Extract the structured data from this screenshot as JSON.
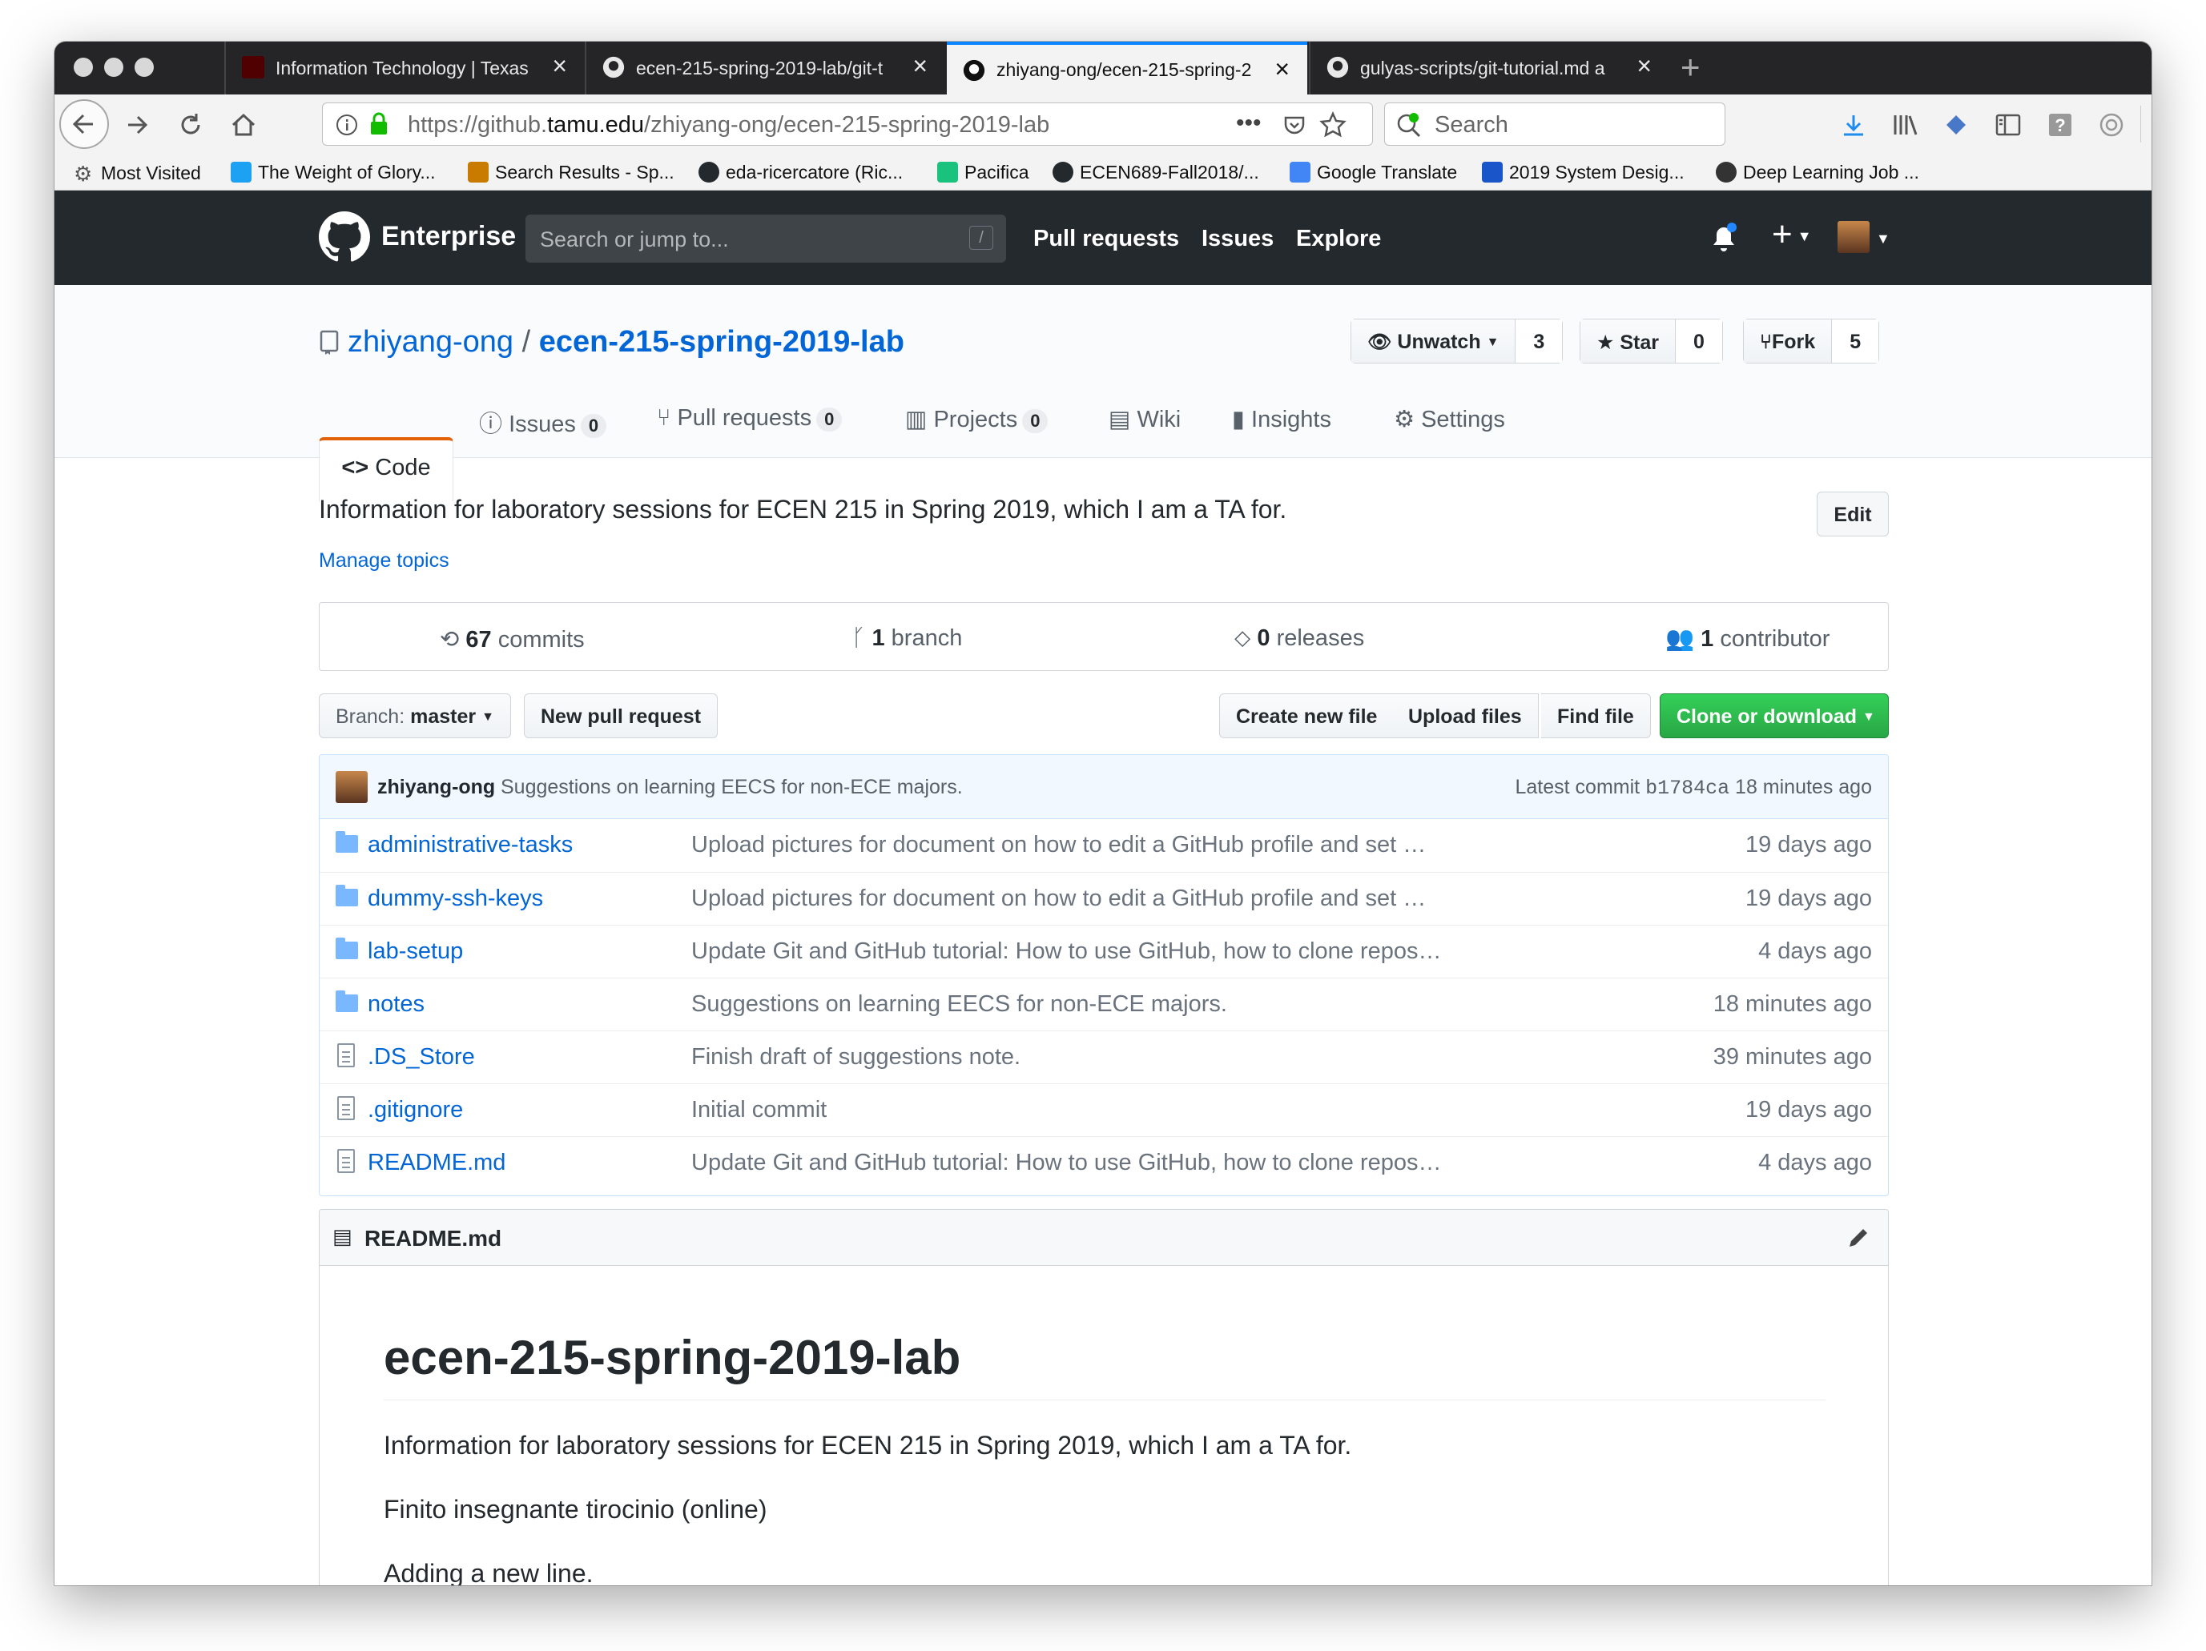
{
  "browser": {
    "tabs": [
      {
        "title": "Information Technology | Texas",
        "active": false
      },
      {
        "title": "ecen-215-spring-2019-lab/git-t",
        "active": false
      },
      {
        "title": "zhiyang-ong/ecen-215-spring-2",
        "active": true
      },
      {
        "title": "gulyas-scripts/git-tutorial.md a",
        "active": false
      }
    ],
    "url_prefix": "https://github.",
    "url_domain": "tamu.edu",
    "url_path": "/zhiyang-ong/ecen-215-spring-2019-lab",
    "more": "•••",
    "search_placeholder": "Search",
    "bookmarks": [
      {
        "label": "Most Visited",
        "color": "#777777"
      },
      {
        "label": "The Weight of Glory...",
        "color": "#1da1f2"
      },
      {
        "label": "Search Results - Sp...",
        "color": "#c97b00"
      },
      {
        "label": "eda-ricercatore (Ric...",
        "color": "#24292e"
      },
      {
        "label": "Pacifica",
        "color": "#19c37d"
      },
      {
        "label": "ECEN689-Fall2018/...",
        "color": "#24292e"
      },
      {
        "label": "Google Translate",
        "color": "#4285f4"
      },
      {
        "label": "2019 System Desig...",
        "color": "#1a56c9"
      },
      {
        "label": "Deep Learning Job ...",
        "color": "#333333"
      }
    ]
  },
  "github_header": {
    "brand": "Enterprise",
    "search_placeholder": "Search or jump to...",
    "search_key": "/",
    "nav": [
      "Pull requests",
      "Issues",
      "Explore"
    ],
    "plus": "+"
  },
  "repo": {
    "owner": "zhiyang-ong",
    "separator": "/",
    "name": "ecen-215-spring-2019-lab",
    "unwatch_label": "Unwatch",
    "watch_count": "3",
    "star_label": "Star",
    "star_count": "0",
    "fork_label": "Fork",
    "fork_count": "5",
    "tabs": [
      {
        "label": "Code"
      },
      {
        "label": "Issues",
        "count": "0"
      },
      {
        "label": "Pull requests",
        "count": "0"
      },
      {
        "label": "Projects",
        "count": "0"
      },
      {
        "label": "Wiki"
      },
      {
        "label": "Insights"
      },
      {
        "label": "Settings"
      }
    ],
    "description": "Information for laboratory sessions for ECEN 215 in Spring 2019, which I am a TA for.",
    "edit_label": "Edit",
    "manage_topics": "Manage topics",
    "summary": {
      "commits_num": "67",
      "commits_label": "commits",
      "branch_num": "1",
      "branch_label": "branch",
      "releases_num": "0",
      "releases_label": "releases",
      "contrib_num": "1",
      "contrib_label": "contributor"
    },
    "branch_prefix": "Branch:",
    "branch_name": "master",
    "new_pr": "New pull request",
    "create_file": "Create new file",
    "upload_files": "Upload files",
    "find_file": "Find file",
    "clone": "Clone or download",
    "latest_commit": {
      "author": "zhiyang-ong",
      "message": "Suggestions on learning EECS for non-ECE majors.",
      "prefix": "Latest commit",
      "sha": "b1784ca",
      "age": "18 minutes ago"
    },
    "files": [
      {
        "name": "administrative-tasks",
        "type": "dir",
        "message": "Upload pictures for document on how to edit a GitHub profile and set …",
        "age": "19 days ago"
      },
      {
        "name": "dummy-ssh-keys",
        "type": "dir",
        "message": "Upload pictures for document on how to edit a GitHub profile and set …",
        "age": "19 days ago"
      },
      {
        "name": "lab-setup",
        "type": "dir",
        "message": "Update Git and GitHub tutorial: How to use GitHub, how to clone repos…",
        "age": "4 days ago"
      },
      {
        "name": "notes",
        "type": "dir",
        "message": "Suggestions on learning EECS for non-ECE majors.",
        "age": "18 minutes ago"
      },
      {
        "name": ".DS_Store",
        "type": "file",
        "message": "Finish draft of suggestions note.",
        "age": "39 minutes ago"
      },
      {
        "name": ".gitignore",
        "type": "file",
        "message": "Initial commit",
        "age": "19 days ago"
      },
      {
        "name": "README.md",
        "type": "file",
        "message": "Update Git and GitHub tutorial: How to use GitHub, how to clone repos…",
        "age": "4 days ago"
      }
    ],
    "readme": {
      "header": "README.md",
      "h1": "ecen-215-spring-2019-lab",
      "p1": "Information for laboratory sessions for ECEN 215 in Spring 2019, which I am a TA for.",
      "p2": "Finito insegnante tirocinio (online)",
      "p3": "Adding a new line."
    }
  },
  "colors": {
    "header_bg": "#24292e",
    "link": "#0366d6",
    "clone_green": "#28a745",
    "code_tab_accent": "#e36209"
  }
}
